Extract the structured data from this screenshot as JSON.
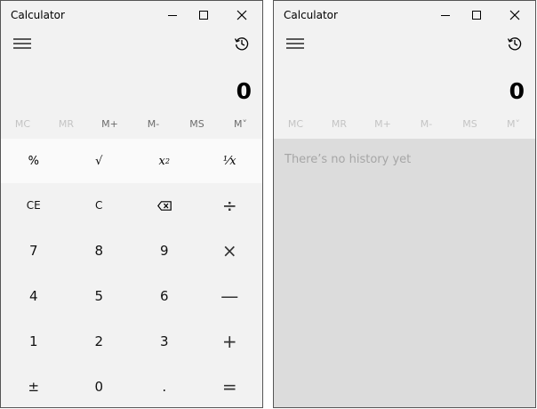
{
  "left": {
    "title": "Calculator",
    "display": "0",
    "memory": [
      "MC",
      "MR",
      "M+",
      "M-",
      "MS",
      "M˅"
    ],
    "scientific": {
      "percent": "%",
      "sqrt": "√",
      "square_base": "x",
      "square_exp": "2",
      "reciprocal": "⅟x"
    },
    "keys": {
      "ce": "CE",
      "c": "C",
      "backspace": "⌫",
      "divide": "÷",
      "seven": "7",
      "eight": "8",
      "nine": "9",
      "multiply": "×",
      "four": "4",
      "five": "5",
      "six": "6",
      "minus": "—",
      "one": "1",
      "two": "2",
      "three": "3",
      "plus": "+",
      "negate": "±",
      "zero": "0",
      "decimal": ".",
      "equals": "="
    },
    "colors": {
      "window_bg": "#f2f2f2",
      "scientific_bg": "#fafafa",
      "memory_disabled": "#c4c4c4"
    }
  },
  "right": {
    "title": "Calculator",
    "display": "0",
    "memory": [
      "MC",
      "MR",
      "M+",
      "M-",
      "MS",
      "M˅"
    ],
    "history_empty": "There’s no history yet",
    "colors": {
      "history_bg": "#dcdcdc",
      "empty_text": "#a6a6a6"
    }
  }
}
